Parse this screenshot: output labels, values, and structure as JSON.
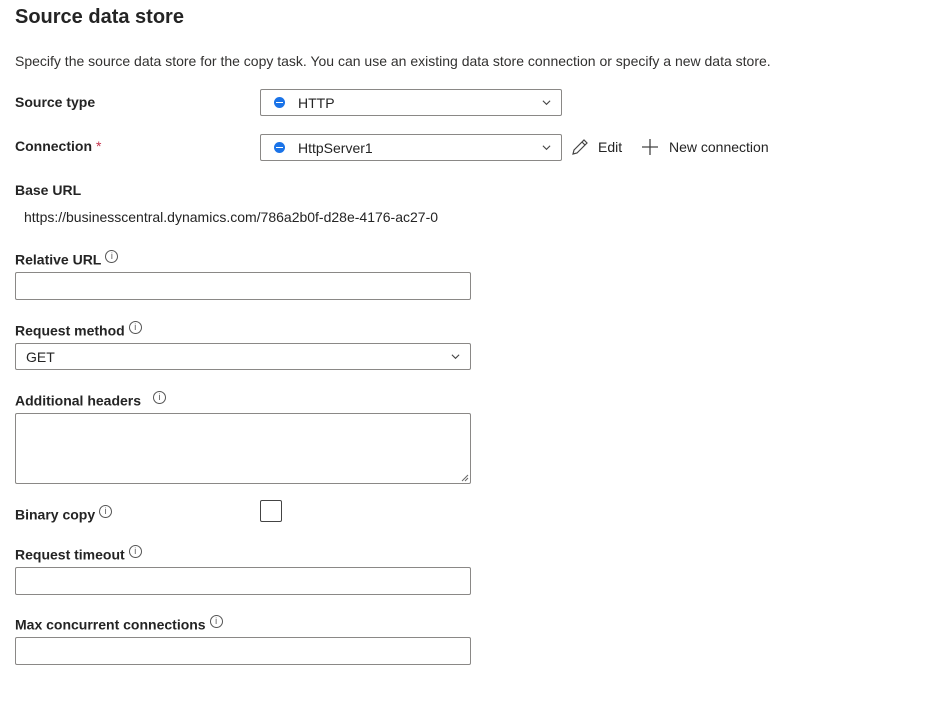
{
  "page": {
    "title": "Source data store",
    "description": "Specify the source data store for the copy task. You can use an existing data store connection or specify a new data store."
  },
  "source_type": {
    "label": "Source type",
    "value": "HTTP"
  },
  "connection": {
    "label": "Connection",
    "required_marker": "*",
    "value": "HttpServer1",
    "edit_label": "Edit",
    "new_connection_label": "New connection"
  },
  "base_url": {
    "label": "Base URL",
    "value": "https://businesscentral.dynamics.com/786a2b0f-d28e-4176-ac27-0"
  },
  "relative_url": {
    "label": "Relative URL",
    "value": ""
  },
  "request_method": {
    "label": "Request method",
    "value": "GET"
  },
  "additional_headers": {
    "label": "Additional headers",
    "value": ""
  },
  "binary_copy": {
    "label": "Binary copy",
    "checked": false
  },
  "request_timeout": {
    "label": "Request timeout",
    "value": ""
  },
  "max_concurrent": {
    "label": "Max concurrent connections",
    "value": ""
  },
  "info_glyph": "i",
  "accent_color": "#1a73e8"
}
